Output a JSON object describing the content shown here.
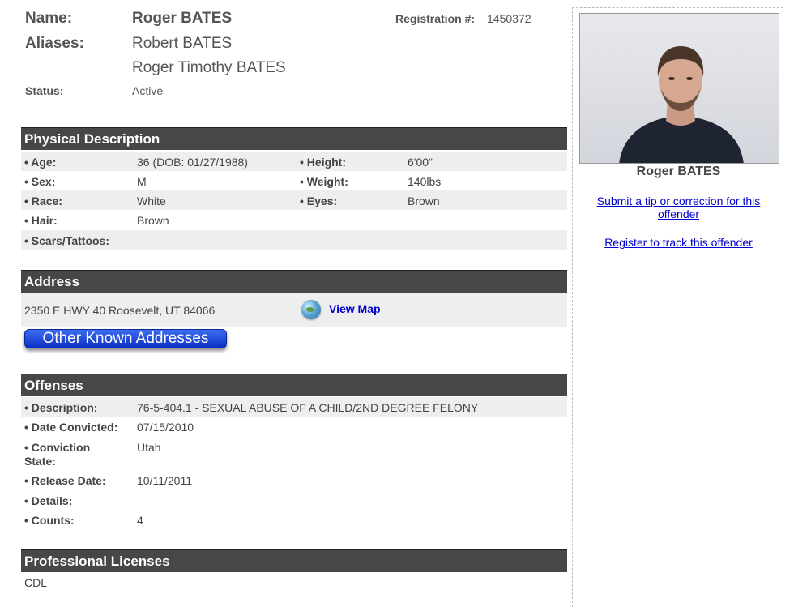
{
  "header": {
    "name_label": "Name:",
    "name_value": "Roger BATES",
    "registration_label": "Registration #:",
    "registration_value": "1450372",
    "aliases_label": "Aliases:",
    "aliases": [
      "Robert BATES",
      "Roger Timothy BATES"
    ],
    "status_label": "Status:",
    "status_value": "Active"
  },
  "physical": {
    "title": "Physical Description",
    "age_label": "• Age:",
    "age_value": "36  (DOB: 01/27/1988)",
    "height_label": "• Height:",
    "height_value": "6'00\"",
    "sex_label": "• Sex:",
    "sex_value": "M",
    "weight_label": "• Weight:",
    "weight_value": "140lbs",
    "race_label": "• Race:",
    "race_value": "White",
    "eyes_label": "• Eyes:",
    "eyes_value": "Brown",
    "hair_label": "• Hair:",
    "hair_value": "Brown",
    "scars_label": "• Scars/Tattoos:",
    "scars_value": ""
  },
  "address": {
    "title": "Address",
    "value": "2350 E HWY 40 Roosevelt, UT 84066",
    "map_icon": "globe-icon",
    "map_link": "View Map",
    "other_button": "Other Known Addresses"
  },
  "offenses": {
    "title": "Offenses",
    "description_label": "• Description:",
    "description_value": "76-5-404.1 - SEXUAL ABUSE OF A CHILD/2ND DEGREE FELONY",
    "date_label": "• Date Convicted:",
    "date_value": "07/15/2010",
    "state_label_1": "• Conviction",
    "state_label_2": "State:",
    "state_value": "Utah",
    "release_label": "• Release Date:",
    "release_value": "10/11/2011",
    "details_label": "• Details:",
    "details_value": "",
    "counts_label": "• Counts:",
    "counts_value": "4"
  },
  "licenses": {
    "title": "Professional Licenses",
    "value": "CDL"
  },
  "sidebar": {
    "name": "Roger BATES",
    "tip_link_line1": "Submit a tip or correction for this",
    "tip_link_line2": "offender",
    "register_link": "Register to track this offender"
  }
}
